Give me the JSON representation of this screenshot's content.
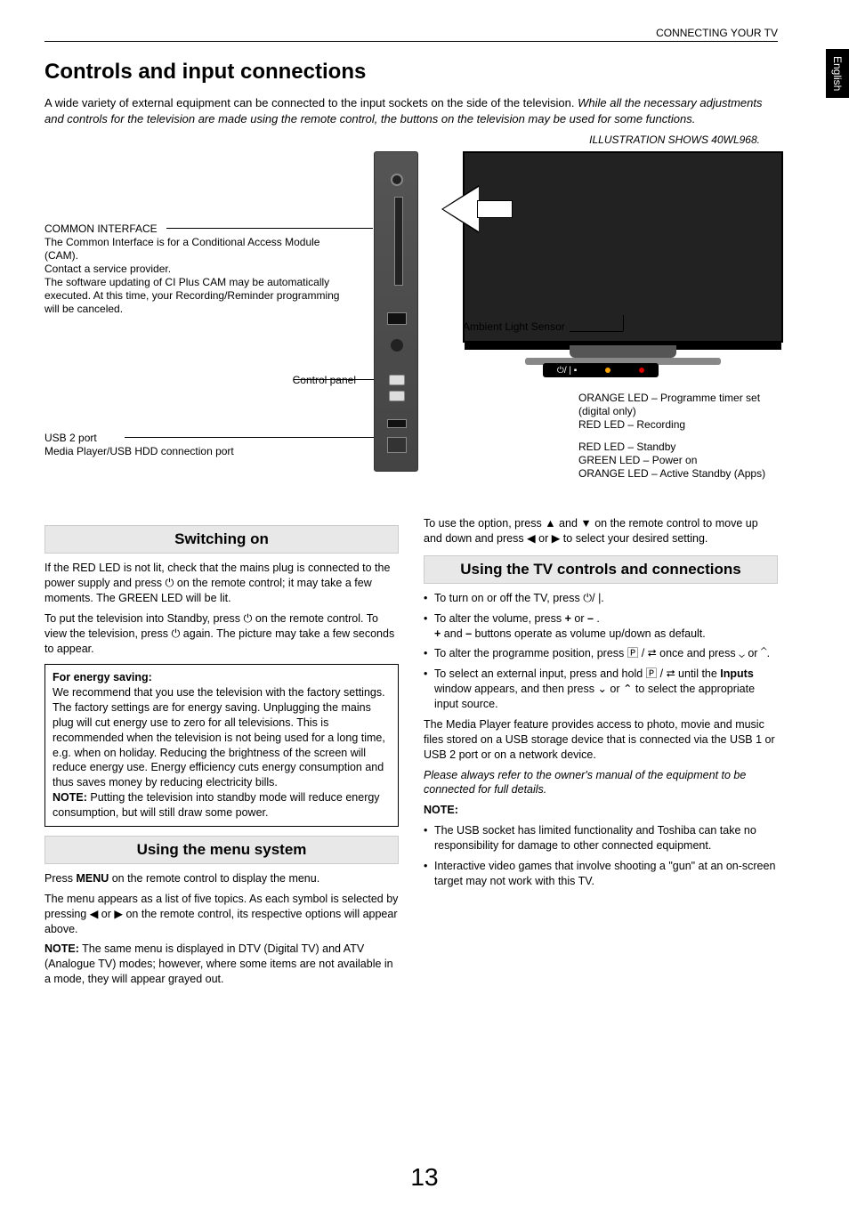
{
  "header": {
    "section": "CONNECTING YOUR TV",
    "lang_tab": "English"
  },
  "title": "Controls and input connections",
  "intro": {
    "line1": "A wide variety of external equipment can be connected to the input sockets on the side of the television.",
    "line2": "While all the necessary adjustments and controls for the television are made using the remote control, the buttons on the television may be used for some functions."
  },
  "diagram": {
    "caption": "ILLUSTRATION SHOWS  40WL968.",
    "ambient": "Ambient Light Sensor",
    "ci_title": "COMMON INTERFACE",
    "ci_body1": "The Common Interface is for a Conditional Access Module (CAM).",
    "ci_body2": "Contact a service provider.",
    "ci_body3": "The software updating of CI Plus CAM may be automatically executed. At this time, your Recording/Reminder programming will be canceled.",
    "control_panel": "Control panel",
    "usb_title": "USB 2 port",
    "usb_body": "Media Player/USB HDD connection port",
    "led_group1_a": "ORANGE LED – Programme timer set (digital only)",
    "led_group1_b": "RED LED – Recording",
    "led_group2_a": "RED LED – Standby",
    "led_group2_b": "GREEN LED – Power on",
    "led_group2_c": "ORANGE LED – Active Standby (Apps)",
    "power_sym": "⏻/ | ▪"
  },
  "left_col": {
    "h1": "Switching on",
    "p1a": "If the RED LED is not lit, check that the mains plug is connected to the power supply and press ",
    "p1b": " on the remote control; it may take a few moments. The GREEN LED will be lit.",
    "p2a": "To put the television into Standby, press ",
    "p2b": " on the remote control. To view the television, press ",
    "p2c": " again. The picture may take a few seconds to appear.",
    "box_title": "For energy saving:",
    "box_body": "We recommend that you use the television with the factory settings. The factory settings are for energy saving. Unplugging the mains plug will cut energy use to zero for all televisions. This is recommended when the television is not being used for a long time, e.g. when on holiday. Reducing the brightness of the screen will reduce energy use. Energy efficiency cuts energy consumption and thus saves money by reducing electricity bills.",
    "box_note_label": "NOTE:",
    "box_note": " Putting the television into standby mode will reduce energy consumption, but will still draw some power.",
    "h2": "Using the menu system",
    "p3a": "Press ",
    "p3_menu": "MENU",
    "p3b": " on the remote control to display the menu.",
    "p4": "The menu appears as a list of five topics. As each symbol is selected by pressing ◀ or ▶ on the remote control, its respective options will appear above.",
    "p5_label": "NOTE:",
    "p5": " The same menu is displayed in DTV (Digital TV) and ATV (Analogue TV) modes; however, where some items are not available in a mode, they will appear grayed out."
  },
  "right_col": {
    "top": "To use the option, press ▲ and ▼ on the remote control to move up and down and press ◀ or ▶ to select your desired setting.",
    "h1": "Using the TV controls and connections",
    "b1": "To turn on or off the TV, press ⏻/ |.",
    "b2a": "To alter the volume, press ",
    "b2_plus": "+",
    "b2_or": " or ",
    "b2_minus": "–",
    "b2b": " .",
    "b2c_a": "+",
    "b2c_mid": " and ",
    "b2c_b": "–",
    "b2c_end": " buttons operate as volume up/down as default.",
    "b3": "To alter the programme position, press 🄿 / ⮂ once and press ⌄ or ⌃.",
    "b4a": "To select an external input, press and hold 🄿 / ⮂ until the ",
    "b4_inputs": "Inputs",
    "b4b": " window appears, and then press ⌄ or ⌃ to select the appropriate input source.",
    "p2": "The Media Player feature provides access to photo, movie and music files stored on a USB storage device that is connected via the USB 1 or USB 2 port or on a network device.",
    "p3": "Please always refer to the owner's manual of the equipment to be connected for full details.",
    "note_label": "NOTE:",
    "n1": "The USB socket has limited functionality and Toshiba can take no responsibility for damage to other connected equipment.",
    "n2": "Interactive video games that involve shooting a \"gun\" at an on-screen target may not work with this TV."
  },
  "page_number": "13"
}
